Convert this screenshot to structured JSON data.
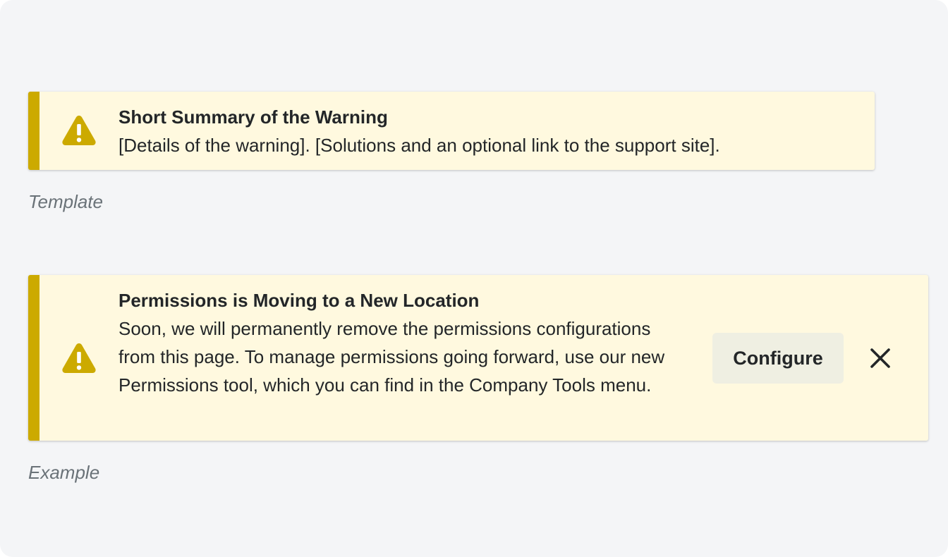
{
  "template_banner": {
    "icon": "warning-icon",
    "title": "Short Summary of the Warning",
    "body": "[Details of the warning]. [Solutions and an optional link to the support site]."
  },
  "template_caption": "Template",
  "example_banner": {
    "icon": "warning-icon",
    "title": "Permissions is Moving to a New Location",
    "body": "Soon, we will permanently remove the permissions configurations from this page. To manage permissions going forward, use our new Permissions tool, which you can find in the Company Tools menu.",
    "configure_label": "Configure",
    "close_icon": "close-icon"
  },
  "example_caption": "Example",
  "colors": {
    "banner_background": "#fff9df",
    "accent_stripe": "#ccaa00",
    "warning_icon": "#ccaa00",
    "page_background": "#f4f5f7",
    "text": "#232628",
    "caption": "#6a7278",
    "button_background": "#efefe2"
  }
}
